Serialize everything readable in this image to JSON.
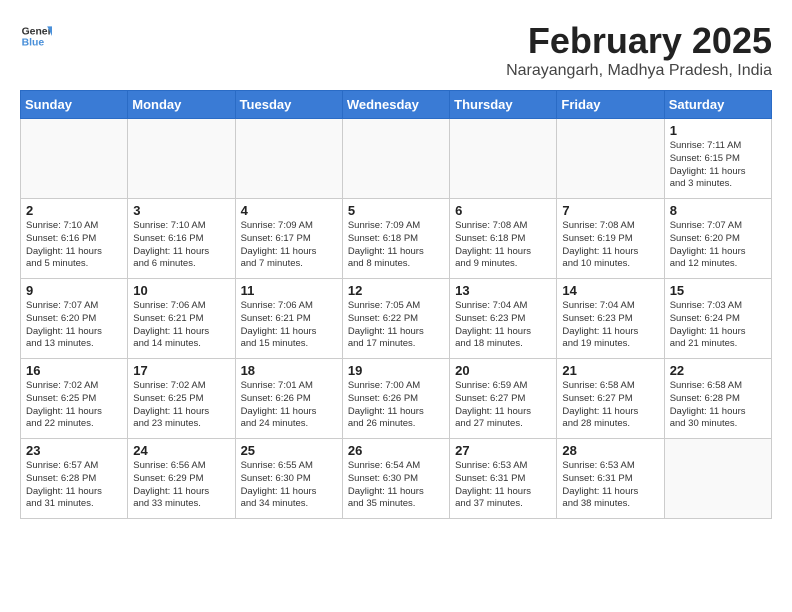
{
  "header": {
    "logo_line1": "General",
    "logo_line2": "Blue",
    "month_title": "February 2025",
    "subtitle": "Narayangarh, Madhya Pradesh, India"
  },
  "weekdays": [
    "Sunday",
    "Monday",
    "Tuesday",
    "Wednesday",
    "Thursday",
    "Friday",
    "Saturday"
  ],
  "weeks": [
    [
      {
        "day": "",
        "info": ""
      },
      {
        "day": "",
        "info": ""
      },
      {
        "day": "",
        "info": ""
      },
      {
        "day": "",
        "info": ""
      },
      {
        "day": "",
        "info": ""
      },
      {
        "day": "",
        "info": ""
      },
      {
        "day": "1",
        "info": "Sunrise: 7:11 AM\nSunset: 6:15 PM\nDaylight: 11 hours\nand 3 minutes."
      }
    ],
    [
      {
        "day": "2",
        "info": "Sunrise: 7:10 AM\nSunset: 6:16 PM\nDaylight: 11 hours\nand 5 minutes."
      },
      {
        "day": "3",
        "info": "Sunrise: 7:10 AM\nSunset: 6:16 PM\nDaylight: 11 hours\nand 6 minutes."
      },
      {
        "day": "4",
        "info": "Sunrise: 7:09 AM\nSunset: 6:17 PM\nDaylight: 11 hours\nand 7 minutes."
      },
      {
        "day": "5",
        "info": "Sunrise: 7:09 AM\nSunset: 6:18 PM\nDaylight: 11 hours\nand 8 minutes."
      },
      {
        "day": "6",
        "info": "Sunrise: 7:08 AM\nSunset: 6:18 PM\nDaylight: 11 hours\nand 9 minutes."
      },
      {
        "day": "7",
        "info": "Sunrise: 7:08 AM\nSunset: 6:19 PM\nDaylight: 11 hours\nand 10 minutes."
      },
      {
        "day": "8",
        "info": "Sunrise: 7:07 AM\nSunset: 6:20 PM\nDaylight: 11 hours\nand 12 minutes."
      }
    ],
    [
      {
        "day": "9",
        "info": "Sunrise: 7:07 AM\nSunset: 6:20 PM\nDaylight: 11 hours\nand 13 minutes."
      },
      {
        "day": "10",
        "info": "Sunrise: 7:06 AM\nSunset: 6:21 PM\nDaylight: 11 hours\nand 14 minutes."
      },
      {
        "day": "11",
        "info": "Sunrise: 7:06 AM\nSunset: 6:21 PM\nDaylight: 11 hours\nand 15 minutes."
      },
      {
        "day": "12",
        "info": "Sunrise: 7:05 AM\nSunset: 6:22 PM\nDaylight: 11 hours\nand 17 minutes."
      },
      {
        "day": "13",
        "info": "Sunrise: 7:04 AM\nSunset: 6:23 PM\nDaylight: 11 hours\nand 18 minutes."
      },
      {
        "day": "14",
        "info": "Sunrise: 7:04 AM\nSunset: 6:23 PM\nDaylight: 11 hours\nand 19 minutes."
      },
      {
        "day": "15",
        "info": "Sunrise: 7:03 AM\nSunset: 6:24 PM\nDaylight: 11 hours\nand 21 minutes."
      }
    ],
    [
      {
        "day": "16",
        "info": "Sunrise: 7:02 AM\nSunset: 6:25 PM\nDaylight: 11 hours\nand 22 minutes."
      },
      {
        "day": "17",
        "info": "Sunrise: 7:02 AM\nSunset: 6:25 PM\nDaylight: 11 hours\nand 23 minutes."
      },
      {
        "day": "18",
        "info": "Sunrise: 7:01 AM\nSunset: 6:26 PM\nDaylight: 11 hours\nand 24 minutes."
      },
      {
        "day": "19",
        "info": "Sunrise: 7:00 AM\nSunset: 6:26 PM\nDaylight: 11 hours\nand 26 minutes."
      },
      {
        "day": "20",
        "info": "Sunrise: 6:59 AM\nSunset: 6:27 PM\nDaylight: 11 hours\nand 27 minutes."
      },
      {
        "day": "21",
        "info": "Sunrise: 6:58 AM\nSunset: 6:27 PM\nDaylight: 11 hours\nand 28 minutes."
      },
      {
        "day": "22",
        "info": "Sunrise: 6:58 AM\nSunset: 6:28 PM\nDaylight: 11 hours\nand 30 minutes."
      }
    ],
    [
      {
        "day": "23",
        "info": "Sunrise: 6:57 AM\nSunset: 6:28 PM\nDaylight: 11 hours\nand 31 minutes."
      },
      {
        "day": "24",
        "info": "Sunrise: 6:56 AM\nSunset: 6:29 PM\nDaylight: 11 hours\nand 33 minutes."
      },
      {
        "day": "25",
        "info": "Sunrise: 6:55 AM\nSunset: 6:30 PM\nDaylight: 11 hours\nand 34 minutes."
      },
      {
        "day": "26",
        "info": "Sunrise: 6:54 AM\nSunset: 6:30 PM\nDaylight: 11 hours\nand 35 minutes."
      },
      {
        "day": "27",
        "info": "Sunrise: 6:53 AM\nSunset: 6:31 PM\nDaylight: 11 hours\nand 37 minutes."
      },
      {
        "day": "28",
        "info": "Sunrise: 6:53 AM\nSunset: 6:31 PM\nDaylight: 11 hours\nand 38 minutes."
      },
      {
        "day": "",
        "info": ""
      }
    ]
  ]
}
